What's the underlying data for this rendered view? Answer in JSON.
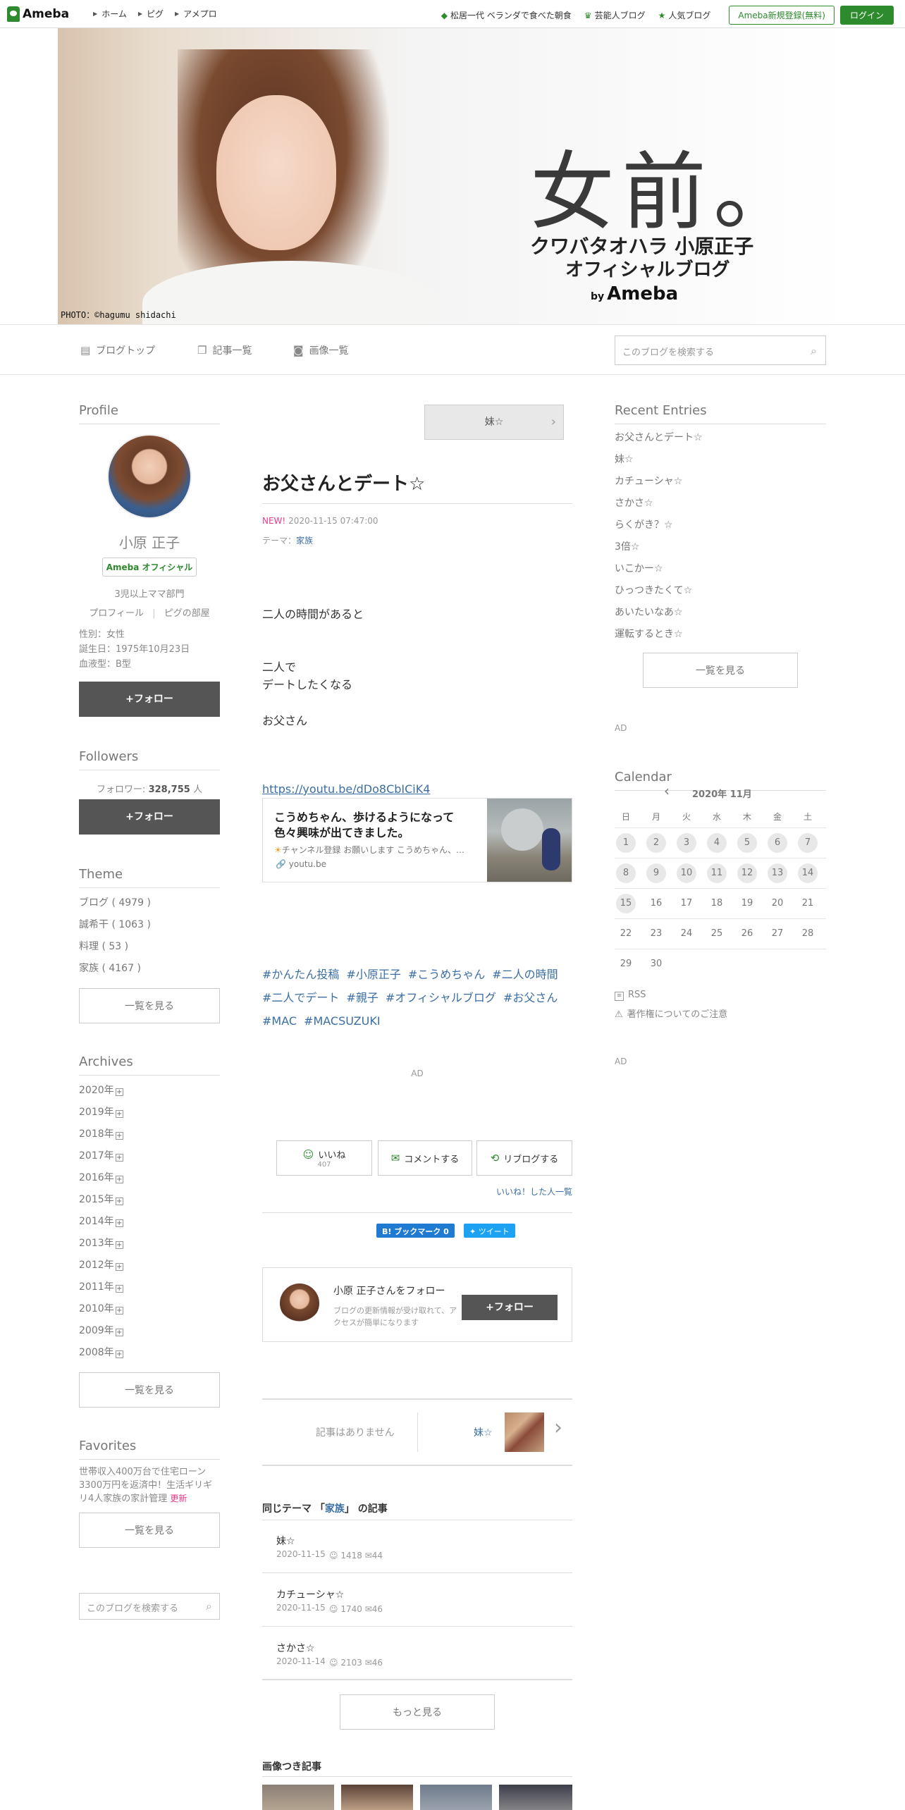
{
  "header": {
    "logo": "Ameba",
    "nav": [
      "ホーム",
      "ピグ",
      "アメプロ"
    ],
    "right_links": [
      "松居一代 ベランダで食べた朝食",
      "芸能人ブログ",
      "人気ブログ"
    ],
    "register": "Ameba新規登録(無料)",
    "login": "ログイン"
  },
  "banner": {
    "title": "女前。",
    "subtitle1": "クワバタオハラ 小原正子",
    "subtitle2": "オフィシャルブログ",
    "by": "by",
    "brand": "Ameba",
    "photo_credit": "PHOTO：©hagumu shidachi"
  },
  "blog_menu": {
    "top": "ブログトップ",
    "entries": "記事一覧",
    "images": "画像一覧",
    "search_placeholder": "このブログを検索する"
  },
  "profile": {
    "heading": "Profile",
    "name": "小原 正子",
    "badge": "Ameba オフィシャル",
    "rank": "3児以上ママ部門",
    "link_profile": "プロフィール",
    "link_room": "ピグの部屋",
    "gender": "性別：女性",
    "birthday": "誕生日：1975年10月23日",
    "blood": "血液型：B型",
    "follow": "+フォロー"
  },
  "followers": {
    "heading": "Followers",
    "label": "フォロワー:",
    "count": "328,755",
    "unit": "人",
    "follow": "+フォロー"
  },
  "theme": {
    "heading": "Theme",
    "items": [
      "ブログ ( 4979 )",
      "誠希干 ( 1063 )",
      "料理 ( 53 )",
      "家族 ( 4167 )"
    ],
    "more": "一覧を見る"
  },
  "archives": {
    "heading": "Archives",
    "years": [
      "2020年",
      "2019年",
      "2018年",
      "2017年",
      "2016年",
      "2015年",
      "2014年",
      "2013年",
      "2012年",
      "2011年",
      "2010年",
      "2009年",
      "2008年"
    ],
    "expand": "+",
    "more": "一覧を見る"
  },
  "favorites": {
    "heading": "Favorites",
    "text": "世帯収入400万台で住宅ローン3300万円を返済中！生活ギリギリ4人家族の家計管理",
    "updated": "更新",
    "more": "一覧を見る",
    "search_placeholder": "このブログを検索する"
  },
  "article": {
    "next_title": "妹☆",
    "title": "お父さんとデート☆",
    "new": "NEW!",
    "datetime": "2020-11-15 07:47:00",
    "theme_label": "テーマ：",
    "theme": "家族",
    "para1": "二人の時間があると",
    "para2a": "二人で",
    "para2b": "デートしたくなる",
    "para3": "お父さん",
    "link": "https://youtu.be/dDo8CbICiK4",
    "embed_title1": "こうめちゃん、歩けるようになって",
    "embed_title2": "色々興味が出てきました。",
    "embed_desc": "チャンネル登録 お願いします こうめちゃん、…",
    "embed_domain": "youtu.be",
    "hashtags": [
      "#かんたん投稿",
      "#小原正子",
      "#こうめちゃん",
      "#二人の時間",
      "#二人でデート",
      "#親子",
      "#オフィシャルブログ",
      "#お父さん",
      "#MAC",
      "#MACSUZUKI"
    ],
    "ad": "AD",
    "like": "いいね",
    "like_count": "407",
    "comment": "コメントする",
    "reblog": "リブログする",
    "liked_list": "いいね！した人一覧",
    "bookmark": "B! ブックマーク",
    "bookmark_count": "0",
    "tweet": "ツイート",
    "follow_box_title": "小原 正子さんをフォロー",
    "follow_box_desc": "ブログの更新情報が受け取れて、アクセスが簡単になります",
    "follow_box_btn": "+フォロー",
    "prev_none": "記事はありません",
    "next_label": "妹☆",
    "related_heading_pre": "同じテーマ 「",
    "related_theme": "家族",
    "related_heading_post": "」 の記事",
    "related": [
      {
        "title": "妹☆",
        "date": "2020-11-15",
        "likes": "1418",
        "comments": "44"
      },
      {
        "title": "カチューシャ☆",
        "date": "2020-11-15",
        "likes": "1740",
        "comments": "46"
      },
      {
        "title": "さかさ☆",
        "date": "2020-11-14",
        "likes": "2103",
        "comments": "46"
      }
    ],
    "more": "もっと見る",
    "image_articles": "画像つき記事"
  },
  "recent": {
    "heading": "Recent Entries",
    "items": [
      "お父さんとデート☆",
      "妹☆",
      "カチューシャ☆",
      "さかさ☆",
      "らくがき？☆",
      "3倍☆",
      "いこかー☆",
      "ひっつきたくて☆",
      "あいたいなあ☆",
      "運転するとき☆"
    ],
    "more": "一覧を見る",
    "ad": "AD"
  },
  "calendar": {
    "heading": "Calendar",
    "month": "2020年 11月",
    "weekdays": [
      "日",
      "月",
      "火",
      "水",
      "木",
      "金",
      "土"
    ],
    "weeks": [
      [
        "1",
        "2",
        "3",
        "4",
        "5",
        "6",
        "7"
      ],
      [
        "8",
        "9",
        "10",
        "11",
        "12",
        "13",
        "14"
      ],
      [
        "15",
        "16",
        "17",
        "18",
        "19",
        "20",
        "21"
      ],
      [
        "22",
        "23",
        "24",
        "25",
        "26",
        "27",
        "28"
      ],
      [
        "29",
        "30",
        "",
        "",
        "",
        "",
        ""
      ]
    ],
    "has_entries": [
      "1",
      "2",
      "3",
      "4",
      "5",
      "6",
      "7",
      "8",
      "9",
      "10",
      "11",
      "12",
      "13",
      "14",
      "15"
    ]
  },
  "footer_links": {
    "rss": "RSS",
    "copyright": "著作権についてのご注意",
    "ad": "AD"
  },
  "colors": {
    "brand_green": "#2d8a2d",
    "link_blue": "#3b6ea5",
    "new_pink": "#e8398d",
    "follow_btn": "#555555"
  }
}
